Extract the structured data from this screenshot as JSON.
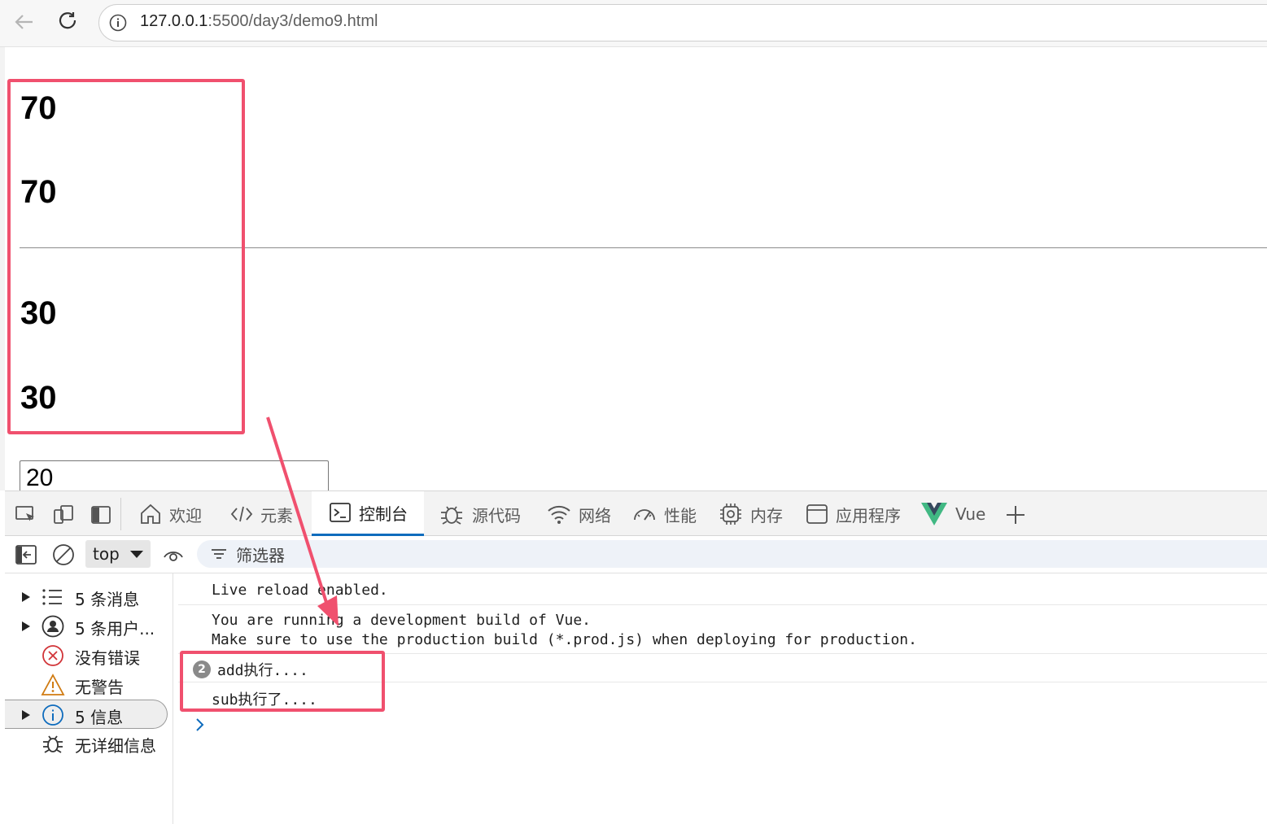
{
  "browser": {
    "url_host": "127.0.0.1",
    "url_rest": ":5500/day3/demo9.html"
  },
  "page": {
    "values": [
      "70",
      "70",
      "30",
      "30"
    ],
    "input_value": "20"
  },
  "devtools": {
    "tabs": [
      {
        "label": "欢迎",
        "icon": "home-icon"
      },
      {
        "label": "元素",
        "icon": "code-icon"
      },
      {
        "label": "控制台",
        "icon": "console-icon",
        "active": true
      },
      {
        "label": "源代码",
        "icon": "bug-icon"
      },
      {
        "label": "网络",
        "icon": "wifi-icon"
      },
      {
        "label": "性能",
        "icon": "performance-icon"
      },
      {
        "label": "内存",
        "icon": "memory-chip-icon"
      },
      {
        "label": "应用程序",
        "icon": "application-icon"
      },
      {
        "label": "Vue",
        "icon": "vue-logo-icon"
      }
    ],
    "context": "top",
    "filter_placeholder": "筛选器",
    "sidebar": [
      {
        "label": "5 条消息",
        "icon": "list-icon"
      },
      {
        "label": "5 条用户...",
        "icon": "user-icon"
      },
      {
        "label": "没有错误",
        "icon": "error-icon"
      },
      {
        "label": "无警告",
        "icon": "warning-icon"
      },
      {
        "label": "5 信息",
        "icon": "info-icon",
        "selected": true
      },
      {
        "label": "无详细信息",
        "icon": "verbose-bug-icon"
      }
    ],
    "console": {
      "messages": [
        {
          "lines": [
            "Live reload enabled."
          ]
        },
        {
          "lines": [
            "You are running a development build of Vue.",
            "Make sure to use the production build (*.prod.js) when deploying for production."
          ]
        },
        {
          "lines": [
            "add执行...."
          ],
          "count": "2"
        },
        {
          "lines": [
            "sub执行了...."
          ]
        }
      ]
    }
  },
  "colors": {
    "highlight": "#f0506e",
    "active_tab_underline": "#0f6cbd",
    "vue_green": "#41b883",
    "vue_dark": "#35495e"
  }
}
